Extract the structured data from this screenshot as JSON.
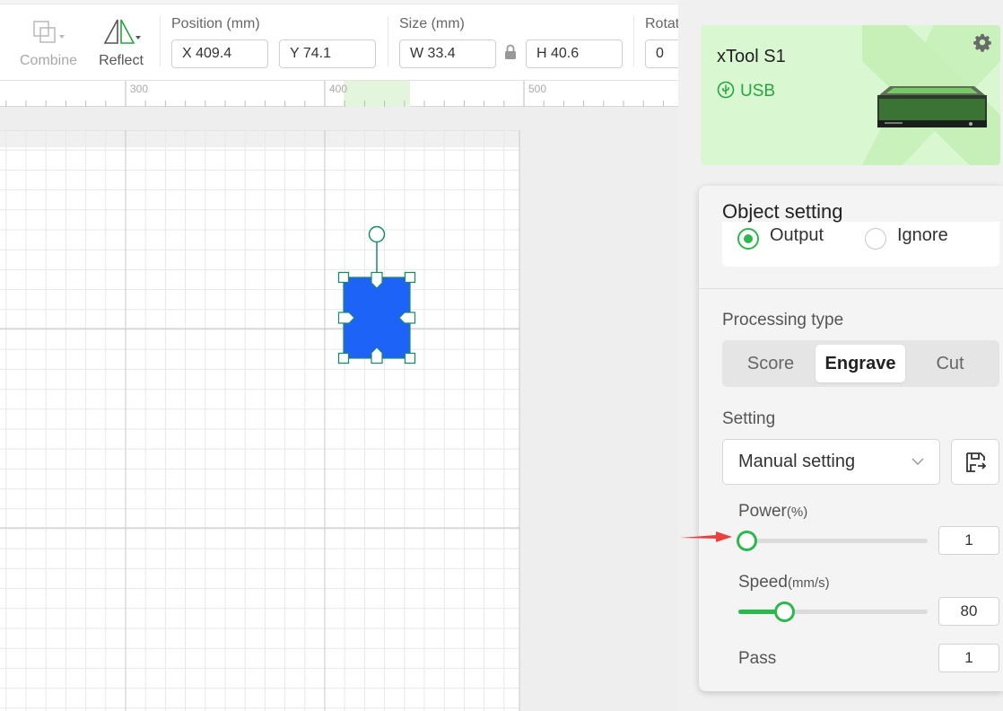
{
  "toolbar": {
    "combine_label": "Combine",
    "reflect_label": "Reflect",
    "position_title": "Position (mm)",
    "x_value": "X 409.4",
    "y_value": "Y 74.1",
    "size_title": "Size (mm)",
    "w_value": "W 33.4",
    "h_value": "H 40.6",
    "rotate_title": "Rotat",
    "rotate_value": "0"
  },
  "ruler": {
    "labels": [
      "300",
      "400",
      "500"
    ]
  },
  "device": {
    "name": "xTool S1",
    "connection": "USB",
    "accent_color": "#26a540",
    "icons": [
      "usb-icon",
      "gear-icon"
    ]
  },
  "object_setting": {
    "title": "Object setting",
    "output_label": "Output",
    "ignore_label": "Ignore",
    "selected": "Output",
    "processing_type_label": "Processing type",
    "processing_types": [
      "Score",
      "Engrave",
      "Cut"
    ],
    "processing_selected": "Engrave",
    "setting_label": "Setting",
    "setting_value": "Manual setting",
    "power": {
      "label": "Power",
      "unit": "(%)",
      "value": "1",
      "min": 1,
      "max": 100
    },
    "speed": {
      "label": "Speed",
      "unit": "(mm/s)",
      "value": "80",
      "min": 1,
      "max": 400
    },
    "pass": {
      "label": "Pass",
      "value": "1"
    }
  },
  "colors": {
    "selected_shape": "#1e63f8",
    "green_accent": "#2db84d",
    "annotation_arrow": "#e94040"
  }
}
